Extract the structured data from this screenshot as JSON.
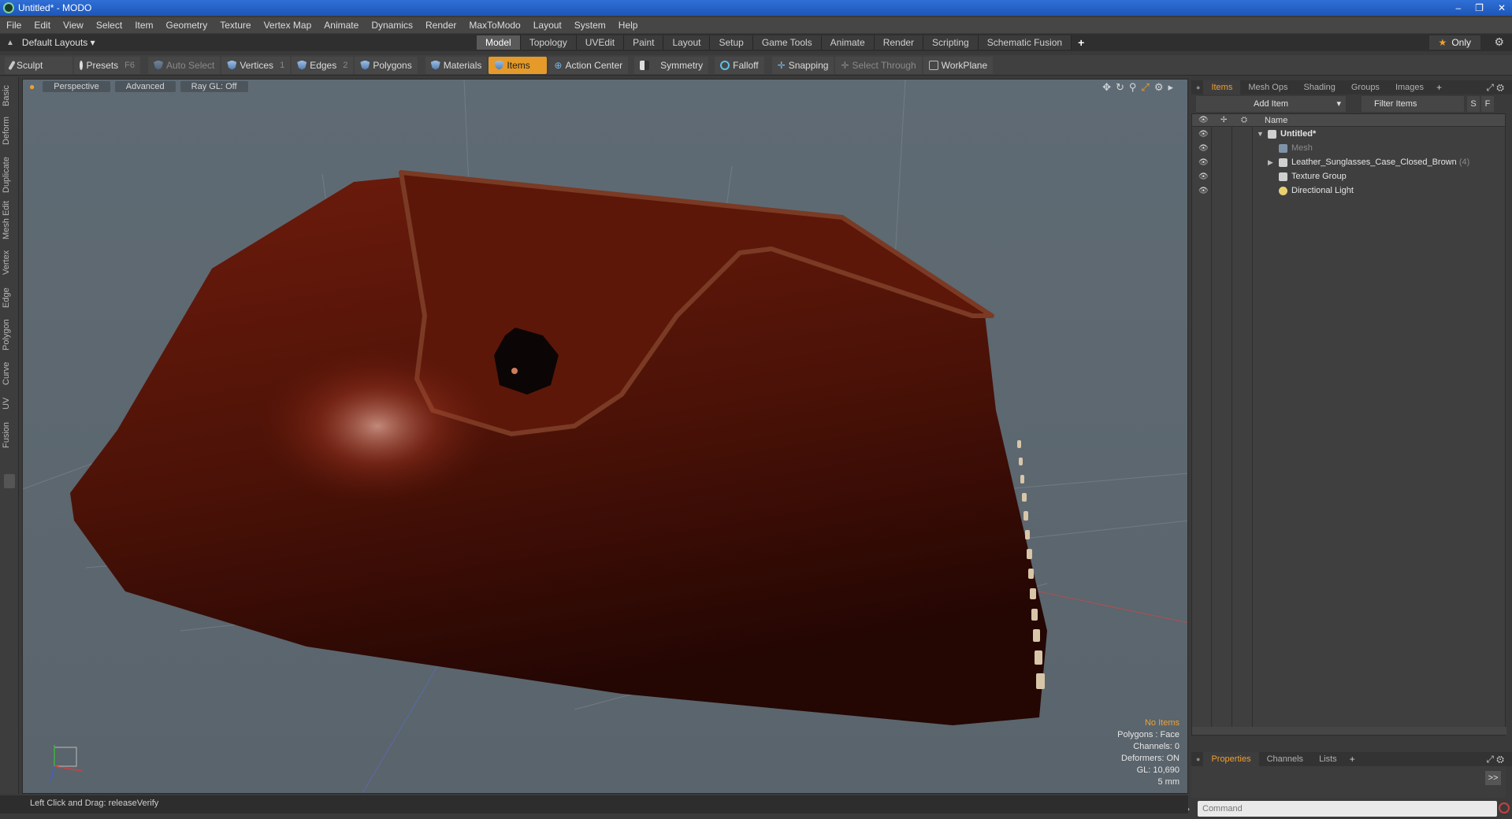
{
  "window": {
    "title": "Untitled* - MODO",
    "controls": [
      "–",
      "❐",
      "✕"
    ]
  },
  "menu": [
    "File",
    "Edit",
    "View",
    "Select",
    "Item",
    "Geometry",
    "Texture",
    "Vertex Map",
    "Animate",
    "Dynamics",
    "Render",
    "MaxToModo",
    "Layout",
    "System",
    "Help"
  ],
  "layout": {
    "selector": "Default Layouts ▾",
    "tabs": [
      "Model",
      "Topology",
      "UVEdit",
      "Paint",
      "Layout",
      "Setup",
      "Game Tools",
      "Animate",
      "Render",
      "Scripting",
      "Schematic Fusion"
    ],
    "active_tab": "Model",
    "add": "+",
    "only_label": "Only"
  },
  "toolbar": {
    "sculpt": "Sculpt",
    "presets": "Presets",
    "presets_shortcut": "F6",
    "auto_select": "Auto Select",
    "vertices": "Vertices",
    "vertices_shortcut": "1",
    "edges": "Edges",
    "edges_shortcut": "2",
    "polygons": "Polygons",
    "materials": "Materials",
    "items": "Items",
    "action_center": "Action Center",
    "symmetry": "Symmetry",
    "falloff": "Falloff",
    "snapping": "Snapping",
    "select_through": "Select Through",
    "workplane": "WorkPlane"
  },
  "left_tabs": [
    "Basic",
    "Deform",
    "Duplicate",
    "Mesh Edit",
    "Vertex",
    "Edge",
    "Polygon",
    "Curve",
    "UV",
    "Fusion"
  ],
  "viewport": {
    "view": "Perspective",
    "shading": "Advanced",
    "raygl": "Ray GL: Off",
    "info": {
      "selection": "No Items",
      "polygons": "Polygons : Face",
      "channels": "Channels: 0",
      "deformers": "Deformers: ON",
      "gl": "GL: 10,690",
      "scale": "5 mm"
    },
    "colors": {
      "background": "#5d6870",
      "leather": "#5a1608",
      "leather_light": "#8a2a14"
    }
  },
  "right_panel": {
    "tabs": [
      "Items",
      "Mesh Ops",
      "Shading",
      "Groups",
      "Images"
    ],
    "active_tab": "Items",
    "add_item": "Add Item",
    "filter_items": "Filter Items",
    "s_button": "S",
    "f_button": "F",
    "column_name": "Name",
    "tree": [
      {
        "label": "Untitled*",
        "bold": true
      },
      {
        "label": "Mesh",
        "dim": true
      },
      {
        "label": "Leather_Sunglasses_Case_Closed_Brown",
        "count": "(4)"
      },
      {
        "label": "Texture Group"
      },
      {
        "label": "Directional Light"
      }
    ],
    "bottom_tabs": [
      "Properties",
      "Channels",
      "Lists"
    ],
    "bottom_active": "Properties",
    "command_placeholder": "Command"
  },
  "status": {
    "text": "Left Click and Drag:   releaseVerify"
  }
}
